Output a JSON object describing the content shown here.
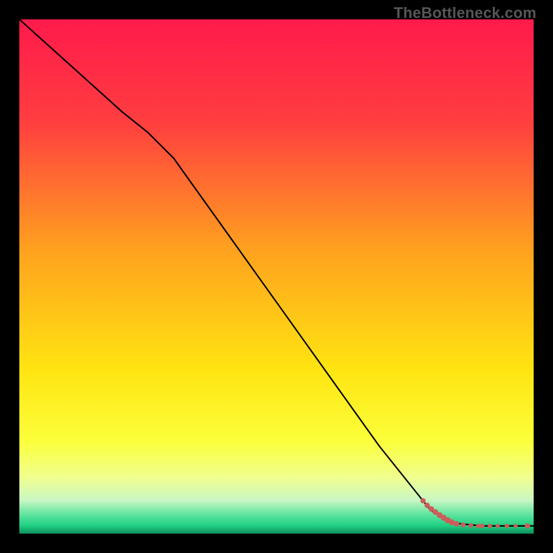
{
  "watermark": "TheBottleneck.com",
  "chart_data": {
    "type": "line",
    "title": "",
    "xlabel": "",
    "ylabel": "",
    "xlim": [
      0,
      100
    ],
    "ylim": [
      0,
      100
    ],
    "background_gradient_stops": [
      {
        "offset": 0.0,
        "color": "#ff1a4b"
      },
      {
        "offset": 0.2,
        "color": "#ff3e40"
      },
      {
        "offset": 0.45,
        "color": "#ffa21e"
      },
      {
        "offset": 0.68,
        "color": "#ffe411"
      },
      {
        "offset": 0.82,
        "color": "#fbff3a"
      },
      {
        "offset": 0.89,
        "color": "#f1ff8e"
      },
      {
        "offset": 0.935,
        "color": "#c9f7c3"
      },
      {
        "offset": 0.965,
        "color": "#57e29d"
      },
      {
        "offset": 0.985,
        "color": "#1fcf82"
      },
      {
        "offset": 1.0,
        "color": "#0e8f5b"
      }
    ],
    "series": [
      {
        "name": "bottleneck-curve",
        "color": "#000000",
        "stroke_width": 2,
        "x": [
          0,
          10,
          20,
          25,
          30,
          40,
          50,
          60,
          70,
          80,
          85,
          90,
          92,
          100
        ],
        "y": [
          100,
          91,
          82,
          78,
          73,
          59,
          45,
          31,
          17,
          4.5,
          2.0,
          1.5,
          1.5,
          1.5
        ]
      }
    ],
    "markers": {
      "name": "highlight-points",
      "color": "#cc5d5a",
      "x": [
        78.5,
        79.3,
        80.1,
        80.9,
        81.7,
        82.5,
        83.3,
        84.1,
        85.0,
        86.3,
        87.8,
        89.2,
        90.0,
        91.5,
        93.0,
        94.8,
        96.5,
        98.8
      ],
      "y": [
        6.4,
        5.5,
        4.8,
        4.2,
        3.6,
        3.1,
        2.6,
        2.2,
        1.9,
        1.7,
        1.6,
        1.5,
        1.5,
        1.5,
        1.5,
        1.5,
        1.5,
        1.5
      ],
      "r": [
        3.8,
        3.9,
        4.0,
        4.1,
        4.2,
        4.3,
        4.4,
        4.2,
        4.0,
        3.6,
        3.4,
        3.2,
        3.3,
        3.2,
        3.0,
        3.2,
        2.9,
        3.8
      ]
    }
  }
}
